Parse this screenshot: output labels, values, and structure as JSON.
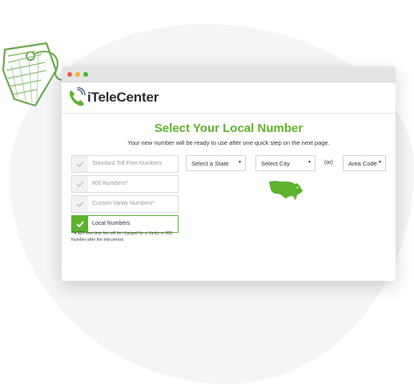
{
  "browser": {
    "controls": [
      "close",
      "minimize",
      "maximize"
    ]
  },
  "header": {
    "logo_text": "iTeleCenter",
    "logo_icon": "phone-icon"
  },
  "main": {
    "title": "Select Your Local Number",
    "subtitle": "Your new number will be ready to use after one quick step on the next page."
  },
  "options": [
    {
      "label": "Standard Toll Free Numbers",
      "selected": false
    },
    {
      "label": "800 Numbers*",
      "selected": false
    },
    {
      "label": "Custom Vanity Numbers*",
      "selected": false
    },
    {
      "label": "Local Numbers",
      "selected": true
    }
  ],
  "footnote": "* A $25 one-time fee will be charged for a Vanity or 800 Number after the trial period.",
  "filters": {
    "state_select": "Select a State",
    "city_select": "Select City",
    "or_label": "(or)",
    "area_code_select": "Area Code"
  },
  "colors": {
    "brand_green": "#5cb32e",
    "text_dark": "#2a2f35"
  }
}
